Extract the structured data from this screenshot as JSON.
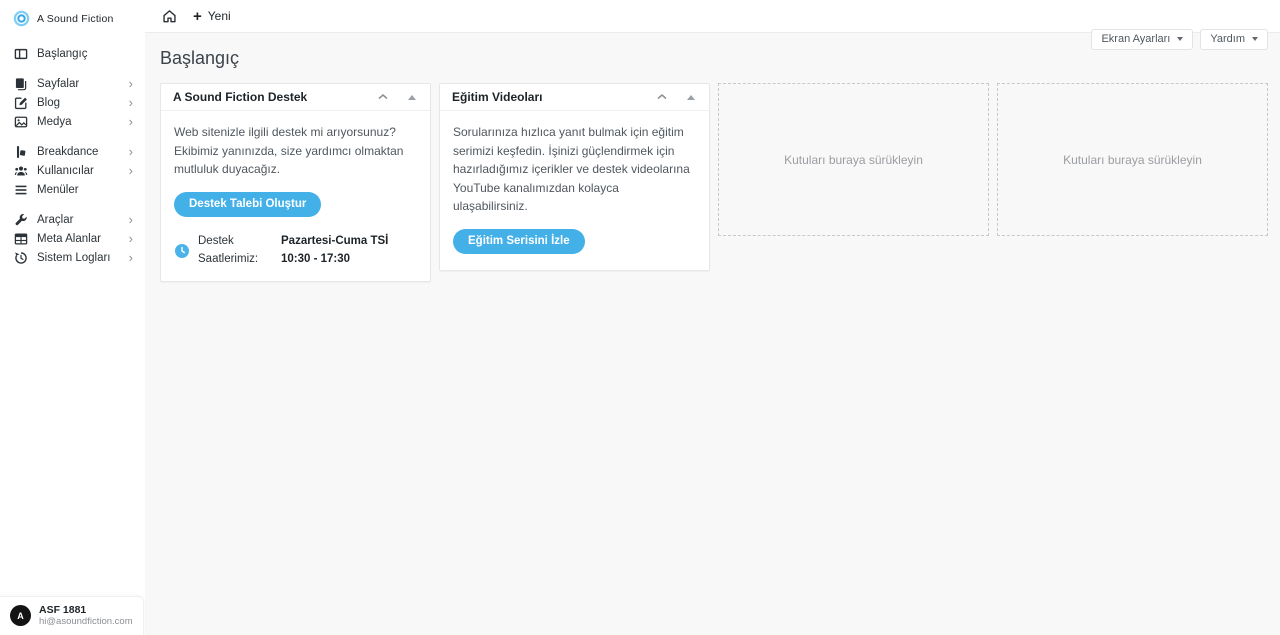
{
  "sidebar": {
    "logo": {
      "label": "A Sound Fiction"
    },
    "groups": [
      {
        "items": [
          {
            "label": "Başlangıç"
          }
        ]
      },
      {
        "items": [
          {
            "label": "Sayfalar"
          },
          {
            "label": "Blog"
          },
          {
            "label": "Medya"
          }
        ]
      },
      {
        "items": [
          {
            "label": "Breakdance"
          },
          {
            "label": "Kullanıcılar"
          },
          {
            "label": "Menüler"
          }
        ]
      },
      {
        "items": [
          {
            "label": "Araçlar"
          },
          {
            "label": "Meta Alanlar"
          },
          {
            "label": "Sistem Logları"
          }
        ]
      }
    ],
    "user": {
      "name": "ASF 1881",
      "email": "hi@asoundfiction.com",
      "avatar_letter": "A"
    }
  },
  "topbar": {
    "new_label": "Yeni"
  },
  "screen_links": {
    "screen_options": "Ekran Ayarları",
    "help": "Yardım"
  },
  "page": {
    "title": "Başlangıç"
  },
  "widgets": {
    "support": {
      "title": "A Sound Fiction Destek",
      "body": "Web sitenizle ilgili destek mi arıyorsunuz? Ekibimiz yanınızda, size yardımcı olmaktan mutluluk duyacağız.",
      "button": "Destek Talebi Oluştur",
      "hours_label": "Destek Saatlerimiz:",
      "hours_value": "Pazartesi-Cuma TSİ 10:30 - 17:30"
    },
    "videos": {
      "title": "Eğitim Videoları",
      "body": "Sorularınıza hızlıca yanıt bulmak için eğitim serimizi keşfedin. İşinizi güçlendirmek için hazırladığımız içerikler ve destek videolarına YouTube kanalımızdan kolayca ulaşabilirsiniz.",
      "button": "Eğitim Serisini İzle"
    }
  },
  "dropzones": {
    "placeholder": "Kutuları buraya sürükleyin"
  },
  "icons": {
    "chevron_right": "›",
    "plus": "+"
  },
  "colors": {
    "accent": "#43b0e8",
    "logo_blue": "#57bdf2",
    "text_dark": "#1d2327",
    "text_muted": "#8c8f94"
  }
}
